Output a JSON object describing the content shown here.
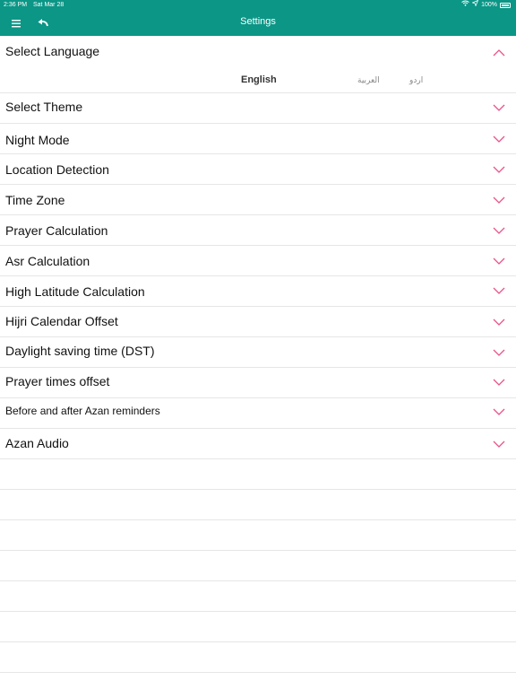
{
  "status_bar": {
    "time": "2:36 PM",
    "date": "Sat Mar 28",
    "battery": "100%"
  },
  "header": {
    "title": "Settings"
  },
  "language_section": {
    "label": "Select Language",
    "options": [
      "English",
      "العربية",
      "اردو"
    ]
  },
  "settings": [
    "Select Theme",
    "Night Mode",
    "Location Detection",
    "Time Zone",
    "Prayer Calculation",
    "Asr Calculation",
    "High Latitude Calculation",
    "Hijri Calendar Offset",
    "Daylight saving time (DST)",
    "Prayer times offset",
    "Before and after Azan reminders",
    "Azan Audio"
  ],
  "colors": {
    "header": "#0b9686",
    "chevron": "#e8538a"
  }
}
